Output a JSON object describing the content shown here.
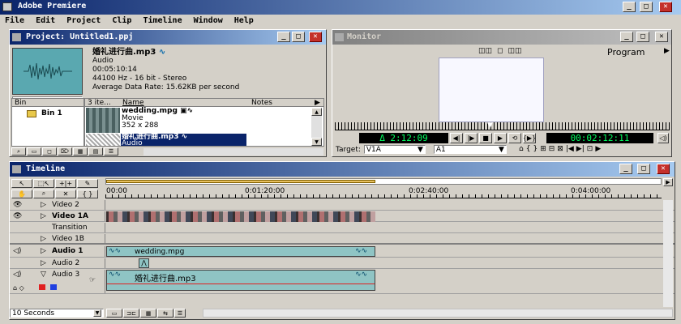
{
  "app": {
    "title": "Adobe Premiere"
  },
  "menu": [
    "File",
    "Edit",
    "Project",
    "Clip",
    "Timeline",
    "Window",
    "Help"
  ],
  "project": {
    "title": "Project: Untitled1.ppj",
    "preview": {
      "name": "婚礼进行曲.mp3",
      "type": "Audio",
      "duration": "00:05:10:14",
      "format": "44100 Hz - 16 bit - Stereo",
      "rate": "Average Data Rate: 15.62KB per second"
    },
    "bin_header": "Bin",
    "bin_item": "Bin 1",
    "count_header": "3 ite...",
    "name_header": "Name",
    "notes_header": "Notes",
    "items": [
      {
        "name": "wedding.mpg",
        "type": "Movie",
        "dims": "352 x 288"
      },
      {
        "name": "婚礼进行曲.mp3",
        "type": "Audio"
      }
    ]
  },
  "monitor": {
    "title": "Monitor",
    "program_label": "Program",
    "timecode_left": "Δ 2:12:09",
    "timecode_right": "00:02:12:11",
    "target_label": "Target:",
    "target_video": "V1A",
    "target_audio": "A1"
  },
  "timeline": {
    "title": "Timeline",
    "ruler": [
      "00:00",
      "0:01:20:00",
      "0:02:40:00",
      "0:04:00:00"
    ],
    "tracks": {
      "video2": "Video 2",
      "video1a": "Video 1A",
      "transition": "Transition",
      "video1b": "Video 1B",
      "audio1": "Audio 1",
      "audio2": "Audio 2",
      "audio3": "Audio 3"
    },
    "clip_video": "wedding.mpg",
    "clip_audio": "婚礼进行曲.mp3",
    "zoom": "10 Seconds"
  },
  "colors": {
    "title_active": "#0a246a",
    "title_inactive": "#808080",
    "clip": "#8fc4c4",
    "timecode_green": "#00ff60"
  }
}
